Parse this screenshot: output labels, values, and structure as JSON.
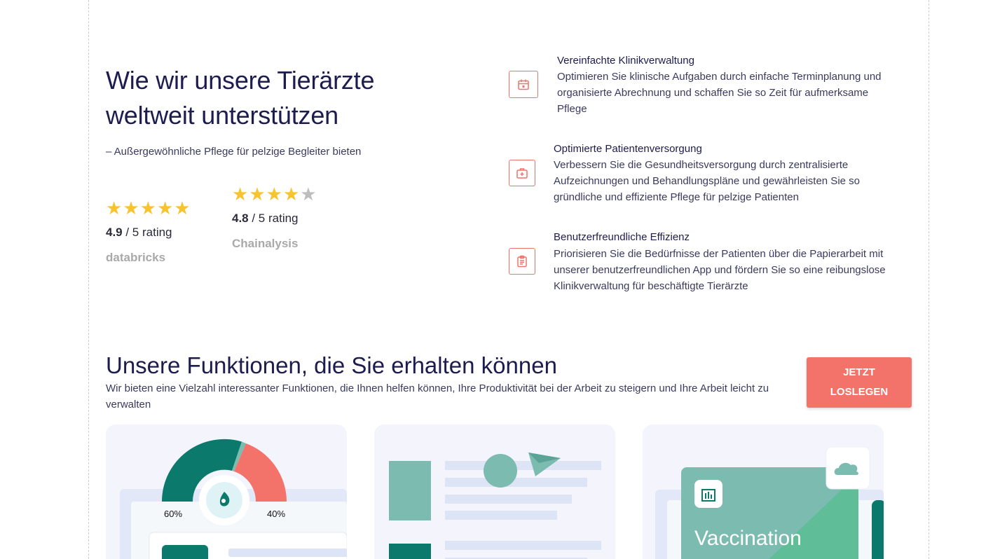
{
  "hero": {
    "title": "Wie wir unsere Tierärzte weltweit unterstützen",
    "subtitle": "– Außergewöhnliche Pflege für pelzige Begleiter bieten"
  },
  "ratings": [
    {
      "stars_filled": 5,
      "stars_total": 5,
      "score": "4.9",
      "suffix": " / 5 rating",
      "brand": "databricks"
    },
    {
      "stars_filled": 4,
      "stars_total": 5,
      "score": "4.8",
      "suffix": " / 5 rating",
      "brand": "Chainalysis"
    }
  ],
  "features": [
    {
      "icon": "calendar-icon",
      "title": "Vereinfachte Klinikverwaltung",
      "description": "Optimieren Sie klinische Aufgaben durch einfache Terminplanung und organisierte Abrechnung und schaffen Sie so Zeit für aufmerksame Pflege"
    },
    {
      "icon": "medical-kit-icon",
      "title": "Optimierte Patientenversorgung",
      "description": "Verbessern Sie die Gesundheitsversorgung durch zentralisierte Aufzeichnungen und Behandlungspläne und gewährleisten Sie so gründliche und effiziente Pflege für pelzige Patienten"
    },
    {
      "icon": "clipboard-icon",
      "title": "Benutzerfreundliche Effizienz",
      "description": "Priorisieren Sie die Bedürfnisse der Patienten über die Papierarbeit mit unserer benutzerfreundlichen App und fördern Sie so eine reibungslose Klinikverwaltung für beschäftigte Tierärzte"
    }
  ],
  "functions": {
    "title": "Unsere Funktionen, die Sie erhalten können",
    "subtitle": "Wir bieten eine Vielzahl interessanter Funktionen, die Ihnen helfen können, Ihre Produktivität bei der Arbeit zu steigern und Ihre Arbeit leicht zu verwalten",
    "cta_label": "JETZT LOSLEGEN"
  },
  "cards": {
    "gauge": {
      "left_label": "60%",
      "right_label": "40%"
    },
    "vaccination_label": "Vaccination"
  },
  "colors": {
    "accent": "#f3736b",
    "teal_dark": "#0b7a6c",
    "teal_light": "#7bbbb0",
    "navy": "#1c1c4f",
    "star": "#f7c32e"
  }
}
